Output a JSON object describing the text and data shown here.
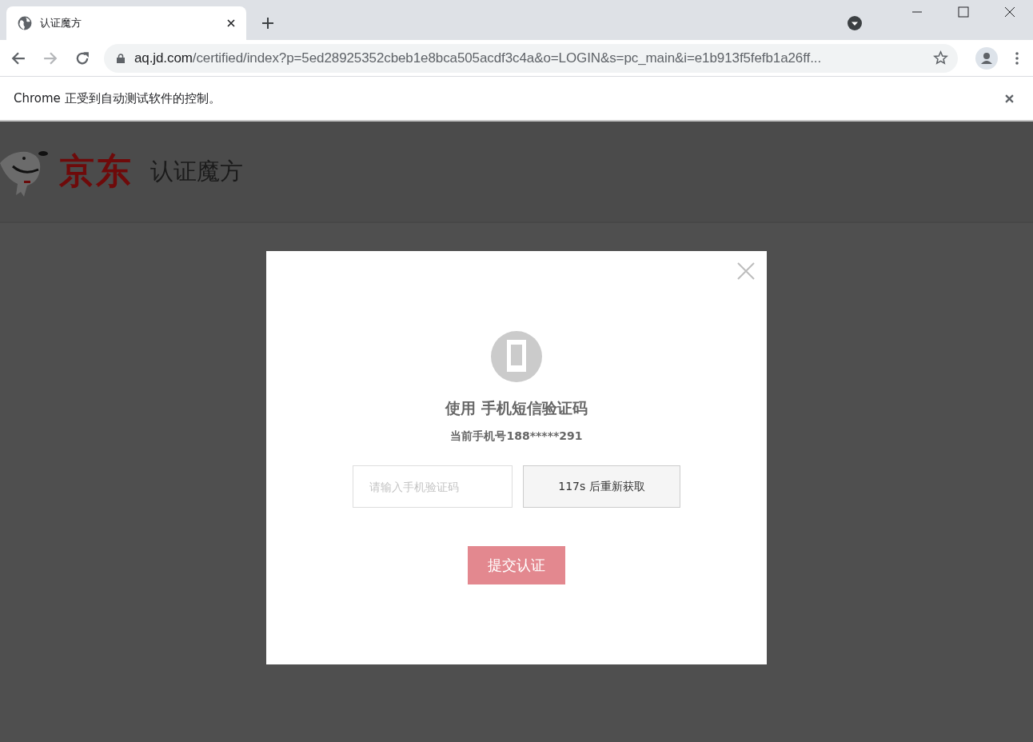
{
  "browser": {
    "tab": {
      "title": "认证魔方"
    },
    "url": {
      "host": "aq.jd.com",
      "path": "/certified/index?p=5ed28925352cbeb1e8bca505acdf3c4a&o=LOGIN&s=pc_main&i=e1b913f5fefb1a26ff..."
    },
    "infobar": {
      "message": "Chrome 正受到自动测试软件的控制。"
    }
  },
  "page": {
    "logo": "京东",
    "product": "认证魔方"
  },
  "dialog": {
    "title": "使用 手机短信验证码",
    "phone": "当前手机号188*****291",
    "code_field": {
      "placeholder": "请输入手机验证码"
    },
    "resend_button": "117s 后重新获取",
    "submit_button": "提交认证"
  }
}
